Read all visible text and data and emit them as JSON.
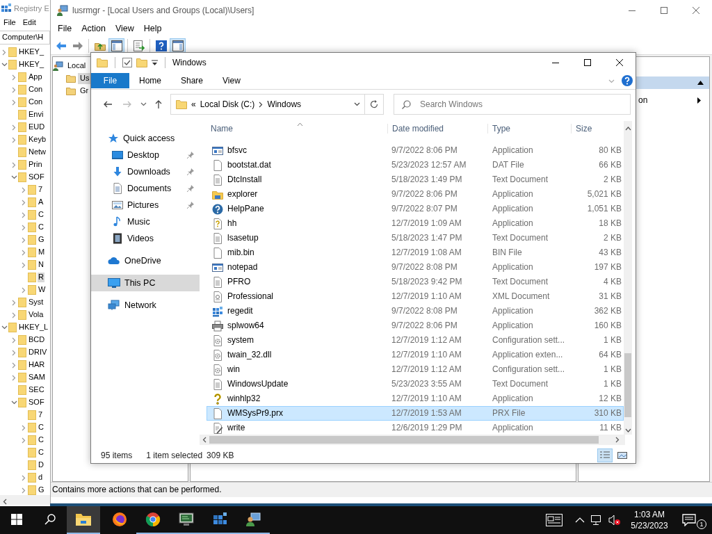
{
  "registry_editor": {
    "title": "Registry E",
    "menu": [
      "File",
      "Edit"
    ],
    "address": "Computer\\H",
    "tree": [
      {
        "label": "HKEY_",
        "kind": "branch",
        "expanded": false,
        "selected": false
      },
      {
        "label": "HKEY_",
        "kind": "branch",
        "expanded": true,
        "selected": false,
        "children": [
          {
            "label": "App",
            "kind": "branch",
            "expanded": false,
            "selected": false
          },
          {
            "label": "Con",
            "kind": "branch",
            "expanded": false,
            "selected": false
          },
          {
            "label": "Con",
            "kind": "branch",
            "expanded": false,
            "selected": false
          },
          {
            "label": "Envi",
            "kind": "leaf",
            "selected": false
          },
          {
            "label": "EUD",
            "kind": "branch",
            "expanded": false,
            "selected": false
          },
          {
            "label": "Keyb",
            "kind": "branch",
            "expanded": false,
            "selected": false
          },
          {
            "label": "Netw",
            "kind": "leaf",
            "selected": false
          },
          {
            "label": "Prin",
            "kind": "branch",
            "expanded": false,
            "selected": false
          },
          {
            "label": "SOF",
            "kind": "branch",
            "expanded": true,
            "selected": false,
            "children": [
              {
                "label": "7",
                "kind": "branch",
                "expanded": false,
                "selected": false
              },
              {
                "label": "A",
                "kind": "branch",
                "expanded": false,
                "selected": false
              },
              {
                "label": "C",
                "kind": "branch",
                "expanded": false,
                "selected": false
              },
              {
                "label": "C",
                "kind": "branch",
                "expanded": false,
                "selected": false
              },
              {
                "label": "G",
                "kind": "branch",
                "expanded": false,
                "selected": false
              },
              {
                "label": "M",
                "kind": "branch",
                "expanded": false,
                "selected": false
              },
              {
                "label": "N",
                "kind": "branch",
                "expanded": false,
                "selected": false
              },
              {
                "label": "R",
                "kind": "leaf",
                "selected": true
              },
              {
                "label": "W",
                "kind": "branch",
                "expanded": false,
                "selected": false
              }
            ]
          },
          {
            "label": "Syst",
            "kind": "branch",
            "expanded": false,
            "selected": false
          },
          {
            "label": "Vola",
            "kind": "branch",
            "expanded": false,
            "selected": false
          }
        ]
      },
      {
        "label": "HKEY_L",
        "kind": "branch",
        "expanded": true,
        "selected": false,
        "children": [
          {
            "label": "BCD",
            "kind": "branch",
            "expanded": false,
            "selected": false
          },
          {
            "label": "DRIV",
            "kind": "branch",
            "expanded": false,
            "selected": false
          },
          {
            "label": "HAR",
            "kind": "branch",
            "expanded": false,
            "selected": false
          },
          {
            "label": "SAM",
            "kind": "branch",
            "expanded": false,
            "selected": false
          },
          {
            "label": "SEC",
            "kind": "leaf",
            "selected": false
          },
          {
            "label": "SOF",
            "kind": "branch",
            "expanded": true,
            "selected": false,
            "children": [
              {
                "label": "7",
                "kind": "leaf",
                "selected": false
              },
              {
                "label": "C",
                "kind": "branch",
                "expanded": false,
                "selected": false
              },
              {
                "label": "C",
                "kind": "branch",
                "expanded": false,
                "selected": false
              },
              {
                "label": "C",
                "kind": "leaf",
                "selected": false
              },
              {
                "label": "D",
                "kind": "leaf",
                "selected": false
              },
              {
                "label": "d",
                "kind": "branch",
                "expanded": false,
                "selected": false
              },
              {
                "label": "G",
                "kind": "branch",
                "expanded": false,
                "selected": false
              }
            ]
          }
        ]
      }
    ]
  },
  "lusrmgr": {
    "title": "lusrmgr - [Local Users and Groups (Local)\\Users]",
    "menu": [
      "File",
      "Action",
      "View",
      "Help"
    ],
    "toolbar": [
      {
        "kind": "back",
        "pressed": false
      },
      {
        "kind": "forward",
        "pressed": false
      },
      {
        "kind": "up",
        "pressed": false
      },
      {
        "kind": "tree",
        "pressed": true
      },
      {
        "kind": "export",
        "pressed": false
      },
      {
        "kind": "help",
        "pressed": false
      },
      {
        "kind": "actions",
        "pressed": true
      }
    ],
    "tree": [
      {
        "label": "Local",
        "selected": false
      },
      {
        "label": "Us",
        "selected": true
      },
      {
        "label": "Gr",
        "selected": false
      }
    ],
    "action_item": "on",
    "status": "Contains more actions that can be performed."
  },
  "explorer": {
    "title": "Windows",
    "ribbon_tabs": [
      {
        "label": "File",
        "selected": true
      },
      {
        "label": "Home",
        "selected": false
      },
      {
        "label": "Share",
        "selected": false
      },
      {
        "label": "View",
        "selected": false
      }
    ],
    "address": {
      "overflow": "«",
      "path": [
        "Local Disk (C:)",
        "Windows"
      ]
    },
    "search": {
      "placeholder": "Search Windows"
    },
    "nav": [
      {
        "label": "Quick access",
        "kind": "star",
        "selected": false,
        "children": [
          {
            "label": "Desktop",
            "kind": "desktop",
            "pinned": true,
            "selected": false
          },
          {
            "label": "Downloads",
            "kind": "download",
            "pinned": true,
            "selected": false
          },
          {
            "label": "Documents",
            "kind": "documents",
            "pinned": true,
            "selected": false
          },
          {
            "label": "Pictures",
            "kind": "pictures",
            "pinned": true,
            "selected": false
          },
          {
            "label": "Music",
            "kind": "music",
            "pinned": false,
            "selected": false
          },
          {
            "label": "Videos",
            "kind": "videos",
            "pinned": false,
            "selected": false
          }
        ]
      },
      {
        "label": "OneDrive",
        "kind": "cloud",
        "selected": false
      },
      {
        "label": "This PC",
        "kind": "pc",
        "selected": true
      },
      {
        "label": "Network",
        "kind": "network",
        "selected": false
      }
    ],
    "columns": [
      "Name",
      "Date modified",
      "Type",
      "Size"
    ],
    "files": [
      {
        "name": "bfsvc",
        "date": "9/7/2022 8:06 PM",
        "type": "Application",
        "size": "80 KB",
        "kind": "app",
        "selected": false
      },
      {
        "name": "bootstat.dat",
        "date": "5/23/2023 12:57 AM",
        "type": "DAT File",
        "size": "66 KB",
        "kind": "file",
        "selected": false
      },
      {
        "name": "DtcInstall",
        "date": "5/18/2023 1:49 PM",
        "type": "Text Document",
        "size": "2 KB",
        "kind": "text",
        "selected": false
      },
      {
        "name": "explorer",
        "date": "9/7/2022 8:06 PM",
        "type": "Application",
        "size": "5,021 KB",
        "kind": "explorer",
        "selected": false
      },
      {
        "name": "HelpPane",
        "date": "9/7/2022 8:07 PM",
        "type": "Application",
        "size": "1,051 KB",
        "kind": "help",
        "selected": false
      },
      {
        "name": "hh",
        "date": "12/7/2019 1:09 AM",
        "type": "Application",
        "size": "18 KB",
        "kind": "helpdoc",
        "selected": false
      },
      {
        "name": "lsasetup",
        "date": "5/18/2023 1:47 PM",
        "type": "Text Document",
        "size": "2 KB",
        "kind": "text",
        "selected": false
      },
      {
        "name": "mib.bin",
        "date": "12/7/2019 1:08 AM",
        "type": "BIN File",
        "size": "43 KB",
        "kind": "file",
        "selected": false
      },
      {
        "name": "notepad",
        "date": "9/7/2022 8:08 PM",
        "type": "Application",
        "size": "197 KB",
        "kind": "app",
        "selected": false
      },
      {
        "name": "PFRO",
        "date": "5/18/2023 9:42 PM",
        "type": "Text Document",
        "size": "4 KB",
        "kind": "text",
        "selected": false
      },
      {
        "name": "Professional",
        "date": "12/7/2019 1:10 AM",
        "type": "XML Document",
        "size": "31 KB",
        "kind": "xml",
        "selected": false
      },
      {
        "name": "regedit",
        "date": "9/7/2022 8:08 PM",
        "type": "Application",
        "size": "362 KB",
        "kind": "registry",
        "selected": false
      },
      {
        "name": "splwow64",
        "date": "9/7/2022 8:06 PM",
        "type": "Application",
        "size": "160 KB",
        "kind": "printer",
        "selected": false
      },
      {
        "name": "system",
        "date": "12/7/2019 1:12 AM",
        "type": "Configuration sett...",
        "size": "1 KB",
        "kind": "config",
        "selected": false
      },
      {
        "name": "twain_32.dll",
        "date": "12/7/2019 1:10 AM",
        "type": "Application exten...",
        "size": "64 KB",
        "kind": "config",
        "selected": false
      },
      {
        "name": "win",
        "date": "12/7/2019 1:12 AM",
        "type": "Configuration sett...",
        "size": "1 KB",
        "kind": "config",
        "selected": false
      },
      {
        "name": "WindowsUpdate",
        "date": "5/23/2023 3:55 AM",
        "type": "Text Document",
        "size": "1 KB",
        "kind": "text",
        "selected": false
      },
      {
        "name": "winhlp32",
        "date": "12/7/2019 1:10 AM",
        "type": "Application",
        "size": "12 KB",
        "kind": "question",
        "selected": false
      },
      {
        "name": "WMSysPr9.prx",
        "date": "12/7/2019 1:53 AM",
        "type": "PRX File",
        "size": "310 KB",
        "kind": "file",
        "selected": true
      },
      {
        "name": "write",
        "date": "12/6/2019 1:29 PM",
        "type": "Application",
        "size": "11 KB",
        "kind": "pen",
        "selected": false
      }
    ],
    "status": {
      "count": "95 items",
      "selection": "1 item selected",
      "size": "309 KB"
    },
    "views": [
      {
        "kind": "details",
        "selected": true
      },
      {
        "kind": "large",
        "selected": false
      }
    ]
  },
  "taskbar": {
    "apps": [
      {
        "kind": "folder",
        "selected": true,
        "running": true
      },
      {
        "kind": "fox",
        "selected": false,
        "running": false
      },
      {
        "kind": "chrome",
        "selected": false,
        "running": true
      },
      {
        "kind": "monitor",
        "selected": false,
        "running": true
      },
      {
        "kind": "cubes",
        "selected": false,
        "running": true
      },
      {
        "kind": "users",
        "selected": false,
        "running": true
      }
    ],
    "clock": {
      "time": "1:03 AM",
      "date": "5/23/2023"
    },
    "notifications": "1"
  }
}
